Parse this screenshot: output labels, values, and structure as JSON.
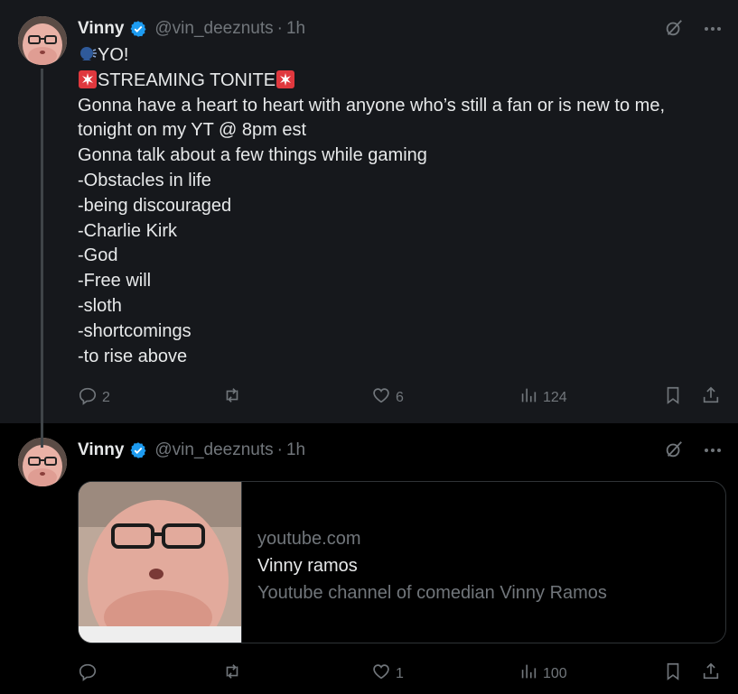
{
  "tweets": [
    {
      "name": "Vinny",
      "handle": "@vin_deeznuts",
      "separator": "·",
      "time": "1h",
      "lines": [
        "YO!",
        "STREAMING TONITE",
        "Gonna have a heart to heart with anyone who’s still a fan or is new to me, tonight on my YT @ 8pm est",
        "Gonna talk about a few things while gaming",
        "-Obstacles in life",
        "-being discouraged",
        "-Charlie Kirk",
        "-God",
        "-Free will",
        "-sloth",
        "-shortcomings",
        "-to rise above"
      ],
      "stats": {
        "replies": "2",
        "reposts": "",
        "likes": "6",
        "views": "124"
      }
    },
    {
      "name": "Vinny",
      "handle": "@vin_deeznuts",
      "separator": "·",
      "time": "1h",
      "card": {
        "domain": "youtube.com",
        "title": "Vinny ramos",
        "description": "Youtube channel of comedian Vinny Ramos"
      },
      "stats": {
        "replies": "",
        "reposts": "",
        "likes": "1",
        "views": "100"
      }
    }
  ],
  "icons": {
    "verified": "verified-badge-icon",
    "grok": "grok-icon",
    "more": "more-icon",
    "reply": "reply-icon",
    "repost": "repost-icon",
    "like": "like-icon",
    "views": "views-icon",
    "bookmark": "bookmark-icon",
    "share": "share-icon",
    "speaking_head": "speaking-head-emoji",
    "siren": "police-light-emoji"
  },
  "colors": {
    "background": "#000000",
    "highlight_background": "#16181c",
    "text": "#e7e9ea",
    "muted": "#71767b",
    "verified": "#1d9bf0",
    "border": "#2f3336"
  }
}
